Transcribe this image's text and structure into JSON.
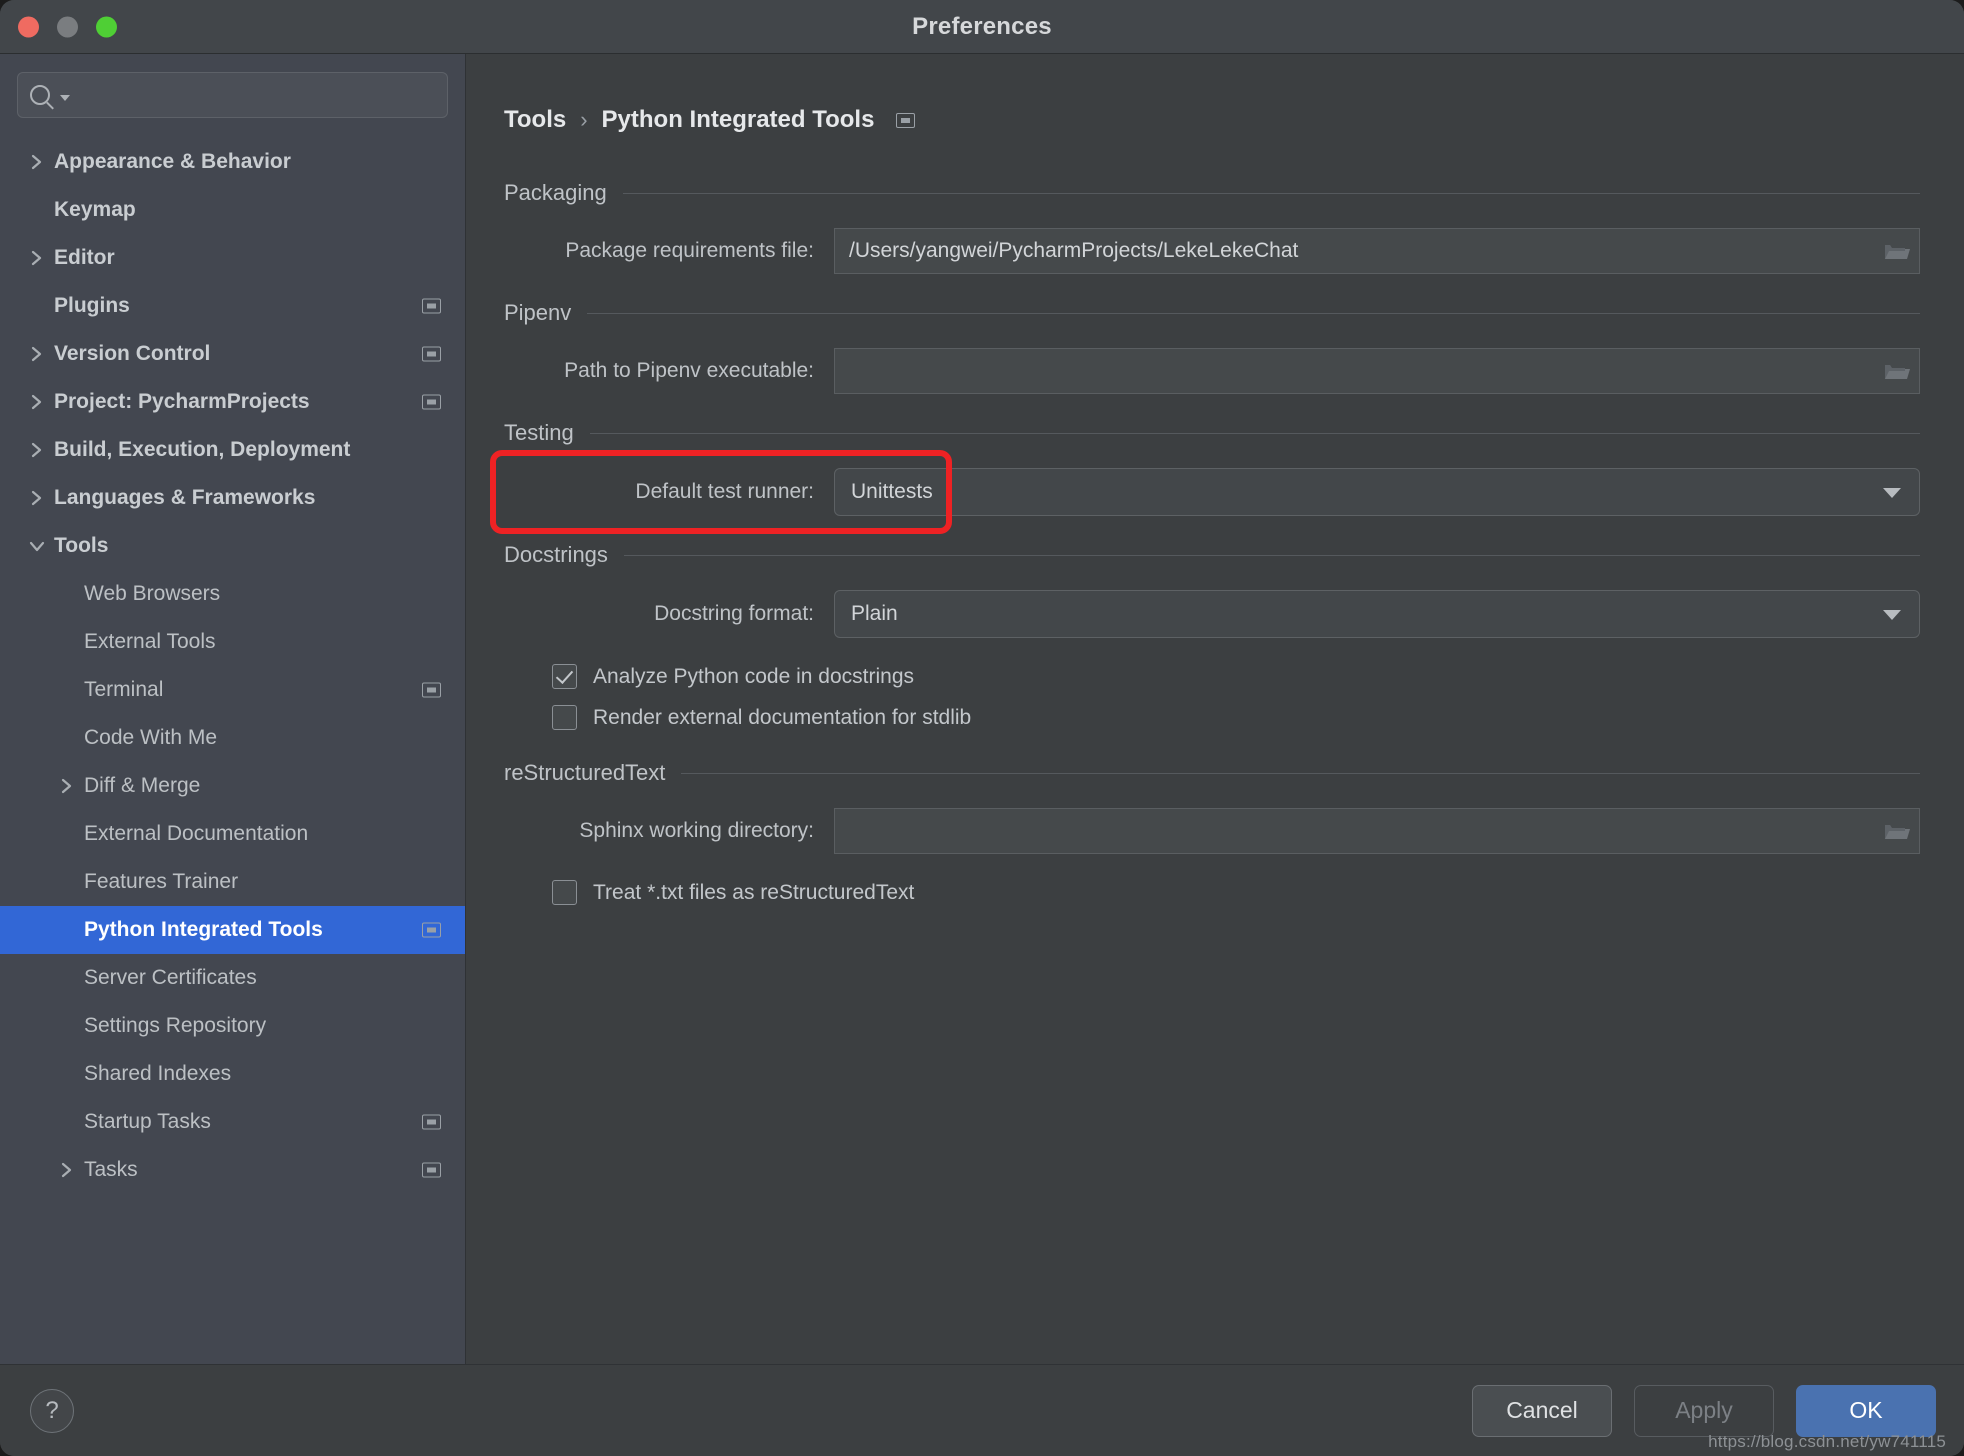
{
  "window": {
    "title": "Preferences",
    "traffic_lights": [
      "close-button",
      "minimize-button",
      "zoom-button"
    ]
  },
  "sidebar": {
    "search": {
      "value": "",
      "placeholder": ""
    },
    "items": [
      {
        "label": "Appearance & Behavior",
        "level": 0,
        "bold": true,
        "chevron": "right",
        "scope": false,
        "selected": false
      },
      {
        "label": "Keymap",
        "level": 0,
        "bold": true,
        "chevron": "none",
        "scope": false,
        "selected": false
      },
      {
        "label": "Editor",
        "level": 0,
        "bold": true,
        "chevron": "right",
        "scope": false,
        "selected": false
      },
      {
        "label": "Plugins",
        "level": 0,
        "bold": true,
        "chevron": "none",
        "scope": true,
        "selected": false
      },
      {
        "label": "Version Control",
        "level": 0,
        "bold": true,
        "chevron": "right",
        "scope": true,
        "selected": false
      },
      {
        "label": "Project: PycharmProjects",
        "level": 0,
        "bold": true,
        "chevron": "right",
        "scope": true,
        "selected": false
      },
      {
        "label": "Build, Execution, Deployment",
        "level": 0,
        "bold": true,
        "chevron": "right",
        "scope": false,
        "selected": false
      },
      {
        "label": "Languages & Frameworks",
        "level": 0,
        "bold": true,
        "chevron": "right",
        "scope": false,
        "selected": false
      },
      {
        "label": "Tools",
        "level": 0,
        "bold": true,
        "chevron": "down",
        "scope": false,
        "selected": false
      },
      {
        "label": "Web Browsers",
        "level": 1,
        "bold": false,
        "chevron": "none",
        "scope": false,
        "selected": false
      },
      {
        "label": "External Tools",
        "level": 1,
        "bold": false,
        "chevron": "none",
        "scope": false,
        "selected": false
      },
      {
        "label": "Terminal",
        "level": 1,
        "bold": false,
        "chevron": "none",
        "scope": true,
        "selected": false
      },
      {
        "label": "Code With Me",
        "level": 1,
        "bold": false,
        "chevron": "none",
        "scope": false,
        "selected": false
      },
      {
        "label": "Diff & Merge",
        "level": 1,
        "bold": false,
        "chevron": "right",
        "scope": false,
        "selected": false
      },
      {
        "label": "External Documentation",
        "level": 1,
        "bold": false,
        "chevron": "none",
        "scope": false,
        "selected": false
      },
      {
        "label": "Features Trainer",
        "level": 1,
        "bold": false,
        "chevron": "none",
        "scope": false,
        "selected": false
      },
      {
        "label": "Python Integrated Tools",
        "level": 1,
        "bold": false,
        "chevron": "none",
        "scope": true,
        "selected": true
      },
      {
        "label": "Server Certificates",
        "level": 1,
        "bold": false,
        "chevron": "none",
        "scope": false,
        "selected": false
      },
      {
        "label": "Settings Repository",
        "level": 1,
        "bold": false,
        "chevron": "none",
        "scope": false,
        "selected": false
      },
      {
        "label": "Shared Indexes",
        "level": 1,
        "bold": false,
        "chevron": "none",
        "scope": false,
        "selected": false
      },
      {
        "label": "Startup Tasks",
        "level": 1,
        "bold": false,
        "chevron": "none",
        "scope": true,
        "selected": false
      },
      {
        "label": "Tasks",
        "level": 1,
        "bold": false,
        "chevron": "right",
        "scope": true,
        "selected": false
      }
    ]
  },
  "content": {
    "breadcrumb": {
      "parent": "Tools",
      "separator": "›",
      "current": "Python Integrated Tools"
    },
    "packaging": {
      "section_title": "Packaging",
      "requirements_label": "Package requirements file:",
      "requirements_value": "/Users/yangwei/PycharmProjects/LekeLekeChat",
      "requirements_placeholder": ""
    },
    "pipenv": {
      "section_title": "Pipenv",
      "path_label": "Path to Pipenv executable:",
      "path_value": "",
      "path_placeholder": ""
    },
    "testing": {
      "section_title": "Testing",
      "runner_label": "Default test runner:",
      "runner_value": "Unittests",
      "highlighted": true,
      "highlight_color": "#ee2224"
    },
    "docstrings": {
      "section_title": "Docstrings",
      "format_label": "Docstring format:",
      "format_value": "Plain",
      "analyze_label": "Analyze Python code in docstrings",
      "analyze_checked": true,
      "render_label": "Render external documentation for stdlib",
      "render_checked": false
    },
    "restructuredtext": {
      "section_title": "reStructuredText",
      "sphinx_label": "Sphinx working directory:",
      "sphinx_value": "",
      "sphinx_placeholder": "",
      "treat_txt_label": "Treat *.txt files as reStructuredText",
      "treat_txt_checked": false
    }
  },
  "footer": {
    "help_label": "?",
    "cancel_label": "Cancel",
    "apply_label": "Apply",
    "apply_enabled": false,
    "ok_label": "OK",
    "watermark": "https://blog.csdn.net/yw741115"
  },
  "colors": {
    "selection_blue": "#3267d6",
    "primary_button": "#4a72b0",
    "annotation_red": "#ee2224",
    "window_bg": "#3c3f41",
    "sidebar_bg": "#434750"
  }
}
